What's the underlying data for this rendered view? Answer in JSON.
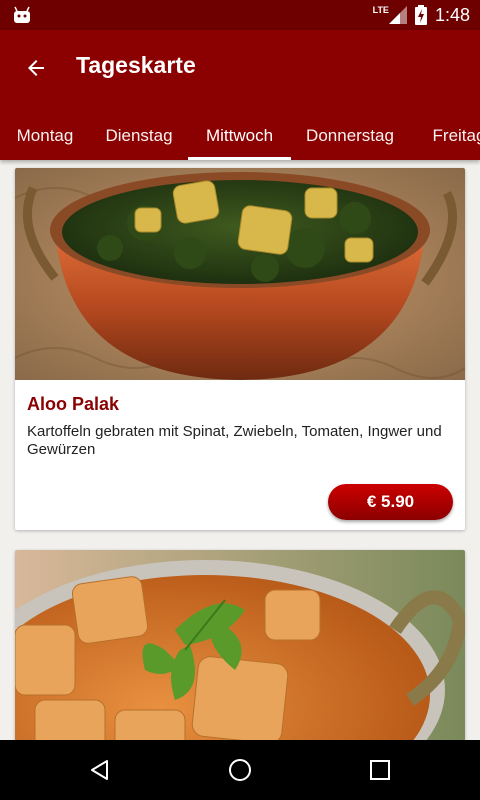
{
  "status_bar": {
    "network": "LTE",
    "time": "1:48",
    "icons": [
      "android-icon",
      "signal-icon",
      "battery-charging-icon"
    ]
  },
  "app_bar": {
    "back_icon": "arrow-back-icon",
    "title": "Tageskarte"
  },
  "tabs": [
    {
      "label": "Montag",
      "active": false
    },
    {
      "label": "Dienstag",
      "active": false
    },
    {
      "label": "Mittwoch",
      "active": true
    },
    {
      "label": "Donnerstag",
      "active": false
    },
    {
      "label": "Freitag",
      "active": false
    }
  ],
  "dishes": [
    {
      "name": "Aloo Palak",
      "description": "Kartoffeln gebraten mit Spinat, Zwiebeln, Tomaten, Ingwer und Gewürzen",
      "price": "€ 5.90",
      "image": "spinach-potato-curry-photo"
    },
    {
      "image": "paneer-curry-photo"
    }
  ],
  "nav_bar": {
    "icons": [
      "back-triangle-icon",
      "home-circle-icon",
      "recents-square-icon"
    ]
  },
  "colors": {
    "primary": "#8b0000",
    "status_bar": "#6e0000",
    "price_button": "#b00000",
    "background": "#f2f0ed"
  }
}
